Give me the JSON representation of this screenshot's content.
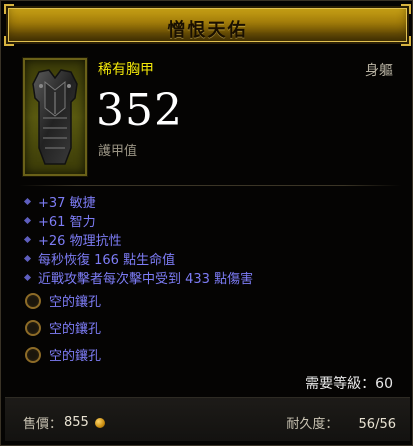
{
  "title": "憎恨天佑",
  "item": {
    "type": "稀有胸甲",
    "slot": "身軀",
    "icon": "chest-armor-icon",
    "armor_value": "352",
    "armor_label": "護甲值"
  },
  "affixes": [
    {
      "text": "+37 敏捷"
    },
    {
      "text": "+61 智力"
    },
    {
      "text": "+26 物理抗性"
    },
    {
      "text": "每秒恢復 166 點生命值"
    },
    {
      "text": "近戰攻擊者每次擊中受到 433 點傷害"
    }
  ],
  "sockets": [
    {
      "label": "空的鑲孔"
    },
    {
      "label": "空的鑲孔"
    },
    {
      "label": "空的鑲孔"
    }
  ],
  "requirement": "需要等級：60",
  "footer": {
    "sell_label": "售價：",
    "sell_value": "855",
    "durability_label": "耐久度：",
    "durability_value": "56/56"
  },
  "colors": {
    "title_gold": "#b08a0e",
    "rare_yellow": "#f1e60a",
    "magic_blue": "#7d7cf5",
    "armor_white": "#ffffff"
  }
}
